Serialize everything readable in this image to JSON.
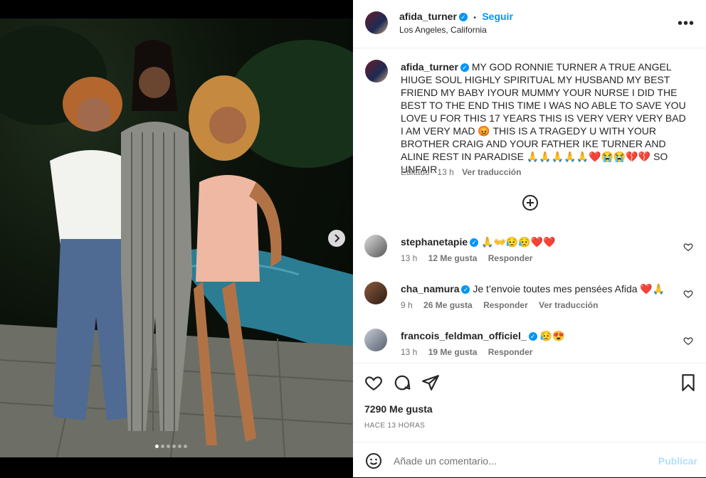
{
  "post": {
    "username": "afida_turner",
    "follow_label": "Seguir",
    "separator": "•",
    "location": "Los Angeles, California",
    "more_label": "•••",
    "caption": "MY GOD RONNIE TURNER A TRUE ANGEL HIUGE SOUL HIGHLY SPIRITUAL MY HUSBAND MY BEST FRIEND MY BABY IYOUR MUMMY YOUR NURSE I DID THE BEST TO THE END THIS TIME I WAS NO ABLE TO SAVE YOU LOVE U FOR THIS 17 YEARS THIS IS VERY VERY VERY BAD I AM VERY MAD 😡 THIS IS A TRAGEDY U WITH YOUR BROTHER CRAIG AND YOUR FATHER IKE TURNER AND ALINE REST IN PARADISE 🙏🙏🙏🙏🙏❤️😭😭💔💔 SO UNFAIR",
    "caption_meta": {
      "edited": "Editado",
      "time": "13 h",
      "translate": "Ver traducción"
    }
  },
  "comments": [
    {
      "username": "stephanetapie",
      "verified": true,
      "text": "🙏👐😥😥❤️❤️",
      "time": "13 h",
      "likes": "12 Me gusta",
      "reply": "Responder",
      "translate": ""
    },
    {
      "username": "cha_namura",
      "verified": true,
      "text": "Je t’envoie toutes mes pensées Afida ❤️🙏",
      "time": "9 h",
      "likes": "26 Me gusta",
      "reply": "Responder",
      "translate": "Ver traducción"
    },
    {
      "username": "francois_feldman_officiel_",
      "verified": true,
      "text": "😥😍",
      "time": "13 h",
      "likes": "19 Me gusta",
      "reply": "Responder",
      "translate": ""
    }
  ],
  "footer": {
    "likes": "7290 Me gusta",
    "ago": "HACE 13 HORAS",
    "comment_placeholder": "Añade un comentario...",
    "publish": "Publicar"
  },
  "carousel": {
    "count": 6,
    "active": 0
  },
  "icons": [
    "verified-badge-icon",
    "more-options-icon",
    "add-circle-icon",
    "heart-icon",
    "comment-icon",
    "share-icon",
    "bookmark-icon",
    "emoji-icon",
    "chevron-right-icon"
  ],
  "colors": {
    "accent": "#0095f6",
    "text": "#262626",
    "muted": "#737373",
    "publish_disabled": "#b2dffc"
  }
}
